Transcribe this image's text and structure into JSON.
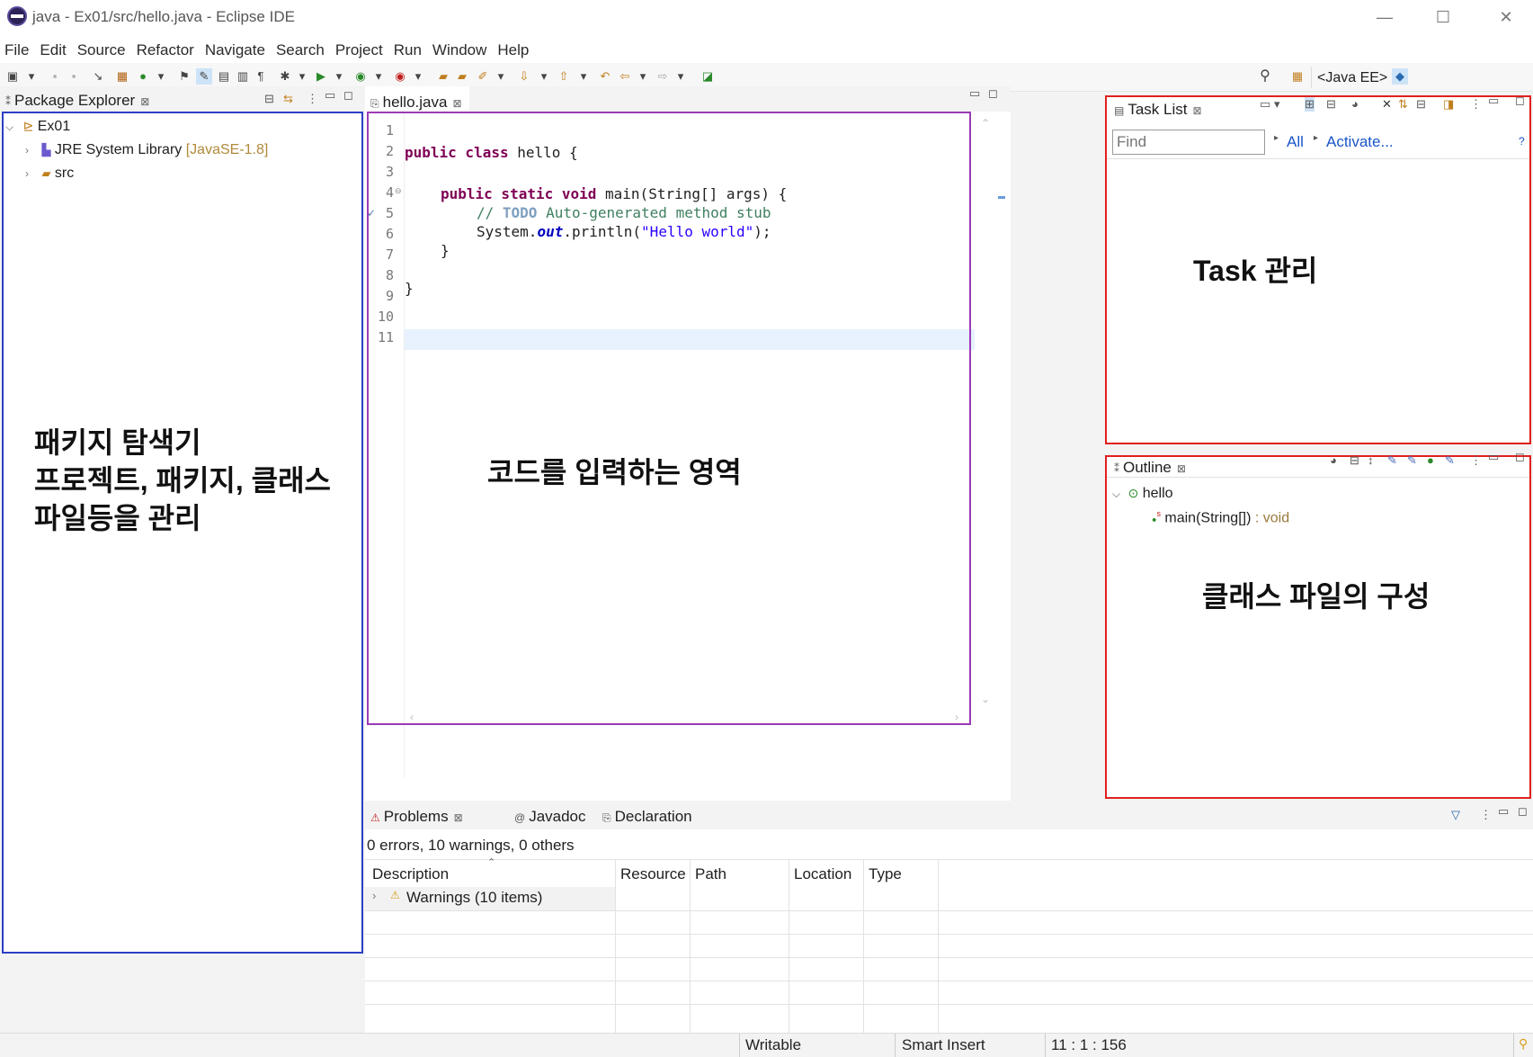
{
  "window": {
    "title": "java - Ex01/src/hello.java - Eclipse IDE",
    "minimize": "—",
    "maximize": "☐",
    "close": "✕"
  },
  "menu": [
    "File",
    "Edit",
    "Source",
    "Refactor",
    "Navigate",
    "Search",
    "Project",
    "Run",
    "Window",
    "Help"
  ],
  "toolbar": {
    "perspective": "<Java EE>"
  },
  "package_explorer": {
    "tab": "Package Explorer",
    "project": "Ex01",
    "jre_label": "JRE System Library",
    "jre_version": "[JavaSE-1.8]",
    "src": "src",
    "annotation_line1": "패키지 탐색기",
    "annotation_line2": "프로젝트, 패키지, 클래스",
    "annotation_line3": "파일등을 관리"
  },
  "editor": {
    "tab": "hello.java",
    "line_numbers": [
      "1",
      "2",
      "3",
      "4",
      "5",
      "6",
      "7",
      "8",
      "9",
      "10",
      "11"
    ],
    "annotation": "코드를 입력하는 영역",
    "code": {
      "l2_kw": "public class",
      "l2_rest": " hello {",
      "l4_kw": "public static void",
      "l4_rest": " main(String[] args) {",
      "l5_pre": "// ",
      "l5_todo": "TODO",
      "l5_rest": " Auto-generated method stub",
      "l6_pre": "System.",
      "l6_out": "out",
      "l6_mid": ".println(",
      "l6_str": "\"Hello world\"",
      "l6_end": ");",
      "l7": "}",
      "l9": "}"
    }
  },
  "task_list": {
    "tab": "Task List",
    "find_placeholder": "Find",
    "all_link": "All",
    "activate_link": "Activate...",
    "annotation": "Task 관리"
  },
  "outline": {
    "tab": "Outline",
    "class_name": "hello",
    "method_name": "main(String[])",
    "method_type": " : void",
    "annotation": "클래스 파일의 구성"
  },
  "problems": {
    "tabs": [
      "Problems",
      "Javadoc",
      "Declaration"
    ],
    "summary": "0 errors, 10 warnings, 0 others",
    "columns": [
      "Description",
      "Resource",
      "Path",
      "Location",
      "Type"
    ],
    "row": "Warnings (10 items)"
  },
  "statusbar": {
    "mode": "Writable",
    "insert": "Smart Insert",
    "position": "11 : 1 : 156"
  },
  "colors": {
    "explorer_outline": "#2b3fc4",
    "editor_outline": "#9b3ab5",
    "task_outline": "#e0201d",
    "link": "#1a56c8"
  }
}
